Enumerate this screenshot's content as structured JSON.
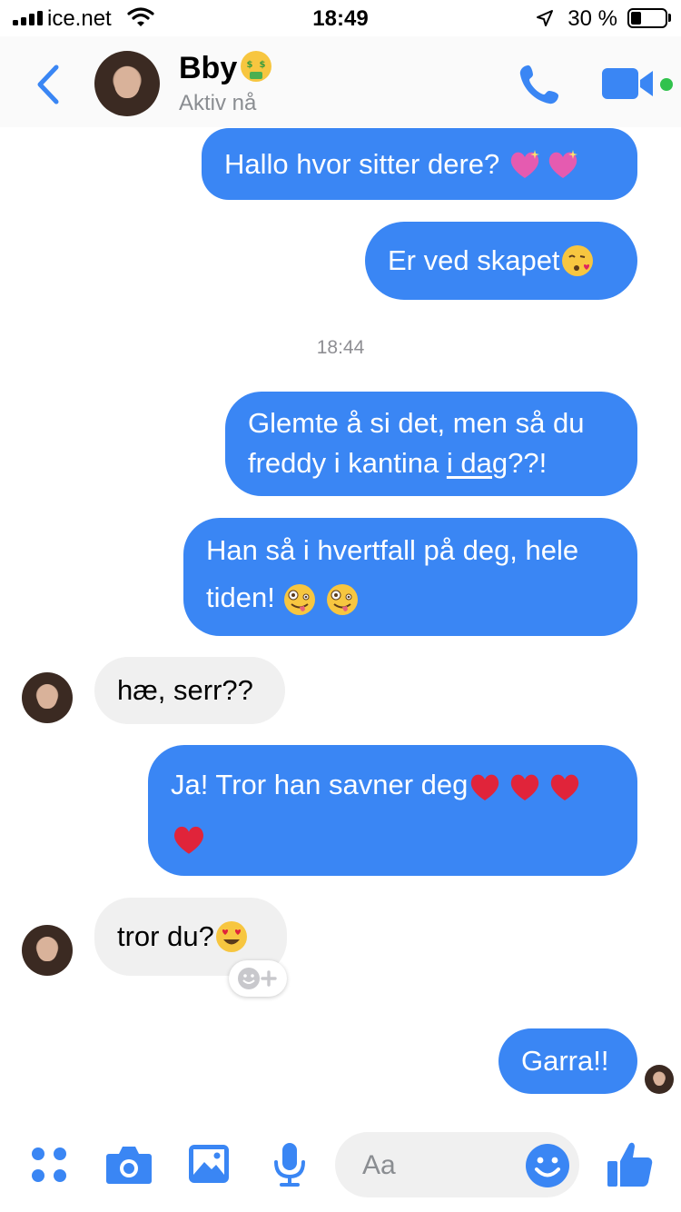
{
  "status_bar": {
    "carrier": "ice.net",
    "time": "18:49",
    "battery_percent": "30 %",
    "battery_level": 0.3
  },
  "header": {
    "name": "Bby",
    "status": "Aktiv nå"
  },
  "conversation": {
    "timestamp": "18:44",
    "messages": [
      {
        "from": "me",
        "parts": [
          "Hallo hvor sitter dere? "
        ]
      },
      {
        "from": "me",
        "parts": [
          "Er ved skapet"
        ]
      },
      {
        "from": "me",
        "line1": "Glemte å si det, men så du",
        "line2_a": "freddy i kantina ",
        "line2_link": "i dag",
        "line2_b": "??!"
      },
      {
        "from": "me",
        "line1": "Han så i hvertfall på deg, hele",
        "line2": "tiden!"
      },
      {
        "from": "them",
        "text": "hæ, serr??"
      },
      {
        "from": "me",
        "line1": "Ja! Tror han savner deg"
      },
      {
        "from": "them",
        "text": "tror du?"
      },
      {
        "from": "me",
        "text": "Garra!!"
      }
    ]
  },
  "composer": {
    "placeholder": "Aa"
  },
  "colors": {
    "accent": "#3a86f4",
    "incoming": "#f0f0f0",
    "active_dot": "#31c24d"
  },
  "icons": [
    "back-chevron-icon",
    "phone-icon",
    "video-camera-icon",
    "more-apps-icon",
    "camera-icon",
    "gallery-icon",
    "microphone-icon",
    "emoji-icon",
    "thumbs-up-icon",
    "add-reaction-icon"
  ]
}
